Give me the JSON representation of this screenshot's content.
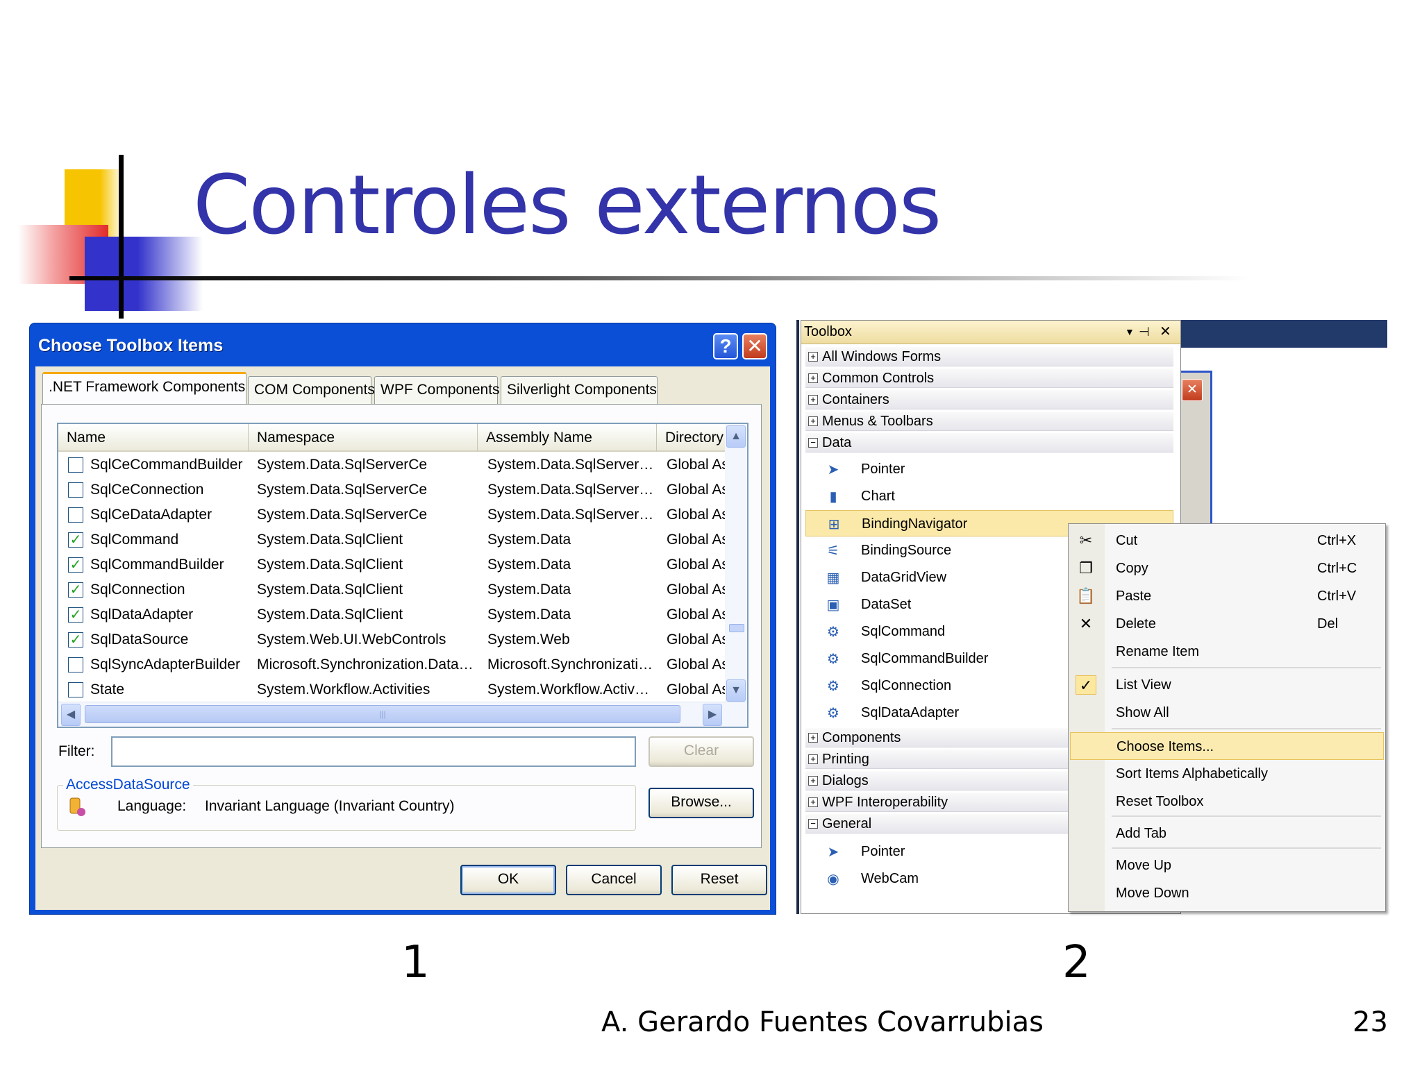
{
  "slide": {
    "title": "Controles externos",
    "label_1": "1",
    "label_2": "2",
    "author": "A. Gerardo Fuentes Covarrubias",
    "page_number": "23"
  },
  "dialog": {
    "title": "Choose Toolbox Items",
    "help": "?",
    "close": "✕",
    "tabs": [
      {
        "label": ".NET Framework Components",
        "active": true
      },
      {
        "label": "COM Components",
        "active": false
      },
      {
        "label": "WPF Components",
        "active": false
      },
      {
        "label": "Silverlight Components",
        "active": false
      }
    ],
    "columns": [
      "Name",
      "Namespace",
      "Assembly Name",
      "Directory"
    ],
    "rows": [
      {
        "checked": false,
        "name": "SqlCeCommandBuilder",
        "namespace": "System.Data.SqlServerCe",
        "assembly": "System.Data.SqlServer…",
        "directory": "Global Ass"
      },
      {
        "checked": false,
        "name": "SqlCeConnection",
        "namespace": "System.Data.SqlServerCe",
        "assembly": "System.Data.SqlServer…",
        "directory": "Global Ass"
      },
      {
        "checked": false,
        "name": "SqlCeDataAdapter",
        "namespace": "System.Data.SqlServerCe",
        "assembly": "System.Data.SqlServer…",
        "directory": "Global Ass"
      },
      {
        "checked": true,
        "name": "SqlCommand",
        "namespace": "System.Data.SqlClient",
        "assembly": "System.Data",
        "directory": "Global Ass"
      },
      {
        "checked": true,
        "name": "SqlCommandBuilder",
        "namespace": "System.Data.SqlClient",
        "assembly": "System.Data",
        "directory": "Global Ass"
      },
      {
        "checked": true,
        "name": "SqlConnection",
        "namespace": "System.Data.SqlClient",
        "assembly": "System.Data",
        "directory": "Global Ass"
      },
      {
        "checked": true,
        "name": "SqlDataAdapter",
        "namespace": "System.Data.SqlClient",
        "assembly": "System.Data",
        "directory": "Global Ass"
      },
      {
        "checked": true,
        "name": "SqlDataSource",
        "namespace": "System.Web.UI.WebControls",
        "assembly": "System.Web",
        "directory": "Global Ass"
      },
      {
        "checked": false,
        "name": "SqlSyncAdapterBuilder",
        "namespace": "Microsoft.Synchronization.Data…",
        "assembly": "Microsoft.Synchronizati…",
        "directory": "Global Ass"
      },
      {
        "checked": false,
        "name": "State",
        "namespace": "System.Workflow.Activities",
        "assembly": "System.Workflow.Activ…",
        "directory": "Global Ass"
      }
    ],
    "filter_label": "Filter:",
    "filter_value": "",
    "clear_label": "Clear",
    "group_label": "AccessDataSource",
    "language_label": "Language:",
    "language_value": "Invariant Language (Invariant Country)",
    "browse_label": "Browse...",
    "ok_label": "OK",
    "cancel_label": "Cancel",
    "reset_label": "Reset"
  },
  "toolbox": {
    "title": "Toolbox",
    "close": "✕",
    "window_close": "✕",
    "categories_top": [
      {
        "label": "All Windows Forms",
        "sign": "+"
      },
      {
        "label": "Common Controls",
        "sign": "+"
      },
      {
        "label": "Containers",
        "sign": "+"
      },
      {
        "label": "Menus & Toolbars",
        "sign": "+"
      },
      {
        "label": "Data",
        "sign": "−"
      }
    ],
    "data_items": [
      {
        "label": "Pointer",
        "icon": "pointer-icon",
        "glyph": "➤"
      },
      {
        "label": "Chart",
        "icon": "chart-icon",
        "glyph": "▮"
      },
      {
        "label": "BindingNavigator",
        "icon": "binding-navigator-icon",
        "glyph": "⊞",
        "selected": true
      },
      {
        "label": "BindingSource",
        "icon": "binding-source-icon",
        "glyph": "⚟"
      },
      {
        "label": "DataGridView",
        "icon": "datagridview-icon",
        "glyph": "▦"
      },
      {
        "label": "DataSet",
        "icon": "dataset-icon",
        "glyph": "▣"
      },
      {
        "label": "SqlCommand",
        "icon": "sqlcommand-icon",
        "glyph": "⚙"
      },
      {
        "label": "SqlCommandBuilder",
        "icon": "sqlcommandbuilder-icon",
        "glyph": "⚙"
      },
      {
        "label": "SqlConnection",
        "icon": "sqlconnection-icon",
        "glyph": "⚙"
      },
      {
        "label": "SqlDataAdapter",
        "icon": "sqldataadapter-icon",
        "glyph": "⚙"
      }
    ],
    "categories_bottom": [
      {
        "label": "Components",
        "sign": "+"
      },
      {
        "label": "Printing",
        "sign": "+"
      },
      {
        "label": "Dialogs",
        "sign": "+"
      },
      {
        "label": "WPF Interoperability",
        "sign": "+"
      },
      {
        "label": "General",
        "sign": "−"
      }
    ],
    "general_items": [
      {
        "label": "Pointer",
        "icon": "pointer-icon",
        "glyph": "➤"
      },
      {
        "label": "WebCam",
        "icon": "webcam-icon",
        "glyph": "◉"
      }
    ]
  },
  "context_menu": {
    "items": [
      {
        "label": "Cut",
        "shortcut": "Ctrl+X",
        "icon": "scissors-icon",
        "glyph": "✂"
      },
      {
        "label": "Copy",
        "shortcut": "Ctrl+C",
        "icon": "copy-icon",
        "glyph": "❐"
      },
      {
        "label": "Paste",
        "shortcut": "Ctrl+V",
        "icon": "paste-icon",
        "glyph": "📋"
      },
      {
        "label": "Delete",
        "shortcut": "Del",
        "icon": "delete-icon",
        "glyph": "✕"
      },
      {
        "label": "Rename Item",
        "shortcut": "",
        "icon": "",
        "glyph": ""
      },
      {
        "label": "List View",
        "shortcut": "",
        "icon": "checkmark-icon",
        "glyph": "✓"
      },
      {
        "label": "Show All",
        "shortcut": "",
        "icon": "",
        "glyph": ""
      },
      {
        "label": "Choose Items...",
        "shortcut": "",
        "icon": "",
        "glyph": "",
        "highlighted": true
      },
      {
        "label": "Sort Items Alphabetically",
        "shortcut": "",
        "icon": "",
        "glyph": ""
      },
      {
        "label": "Reset Toolbox",
        "shortcut": "",
        "icon": "",
        "glyph": ""
      },
      {
        "label": "Add Tab",
        "shortcut": "",
        "icon": "",
        "glyph": ""
      },
      {
        "label": "Move Up",
        "shortcut": "",
        "icon": "",
        "glyph": ""
      },
      {
        "label": "Move Down",
        "shortcut": "",
        "icon": "",
        "glyph": ""
      }
    ]
  },
  "colors": {
    "title_blue": "#3333aa",
    "xp_blue": "#0a4fd6",
    "highlight": "#fcebb0",
    "check_green": "#21a121"
  }
}
